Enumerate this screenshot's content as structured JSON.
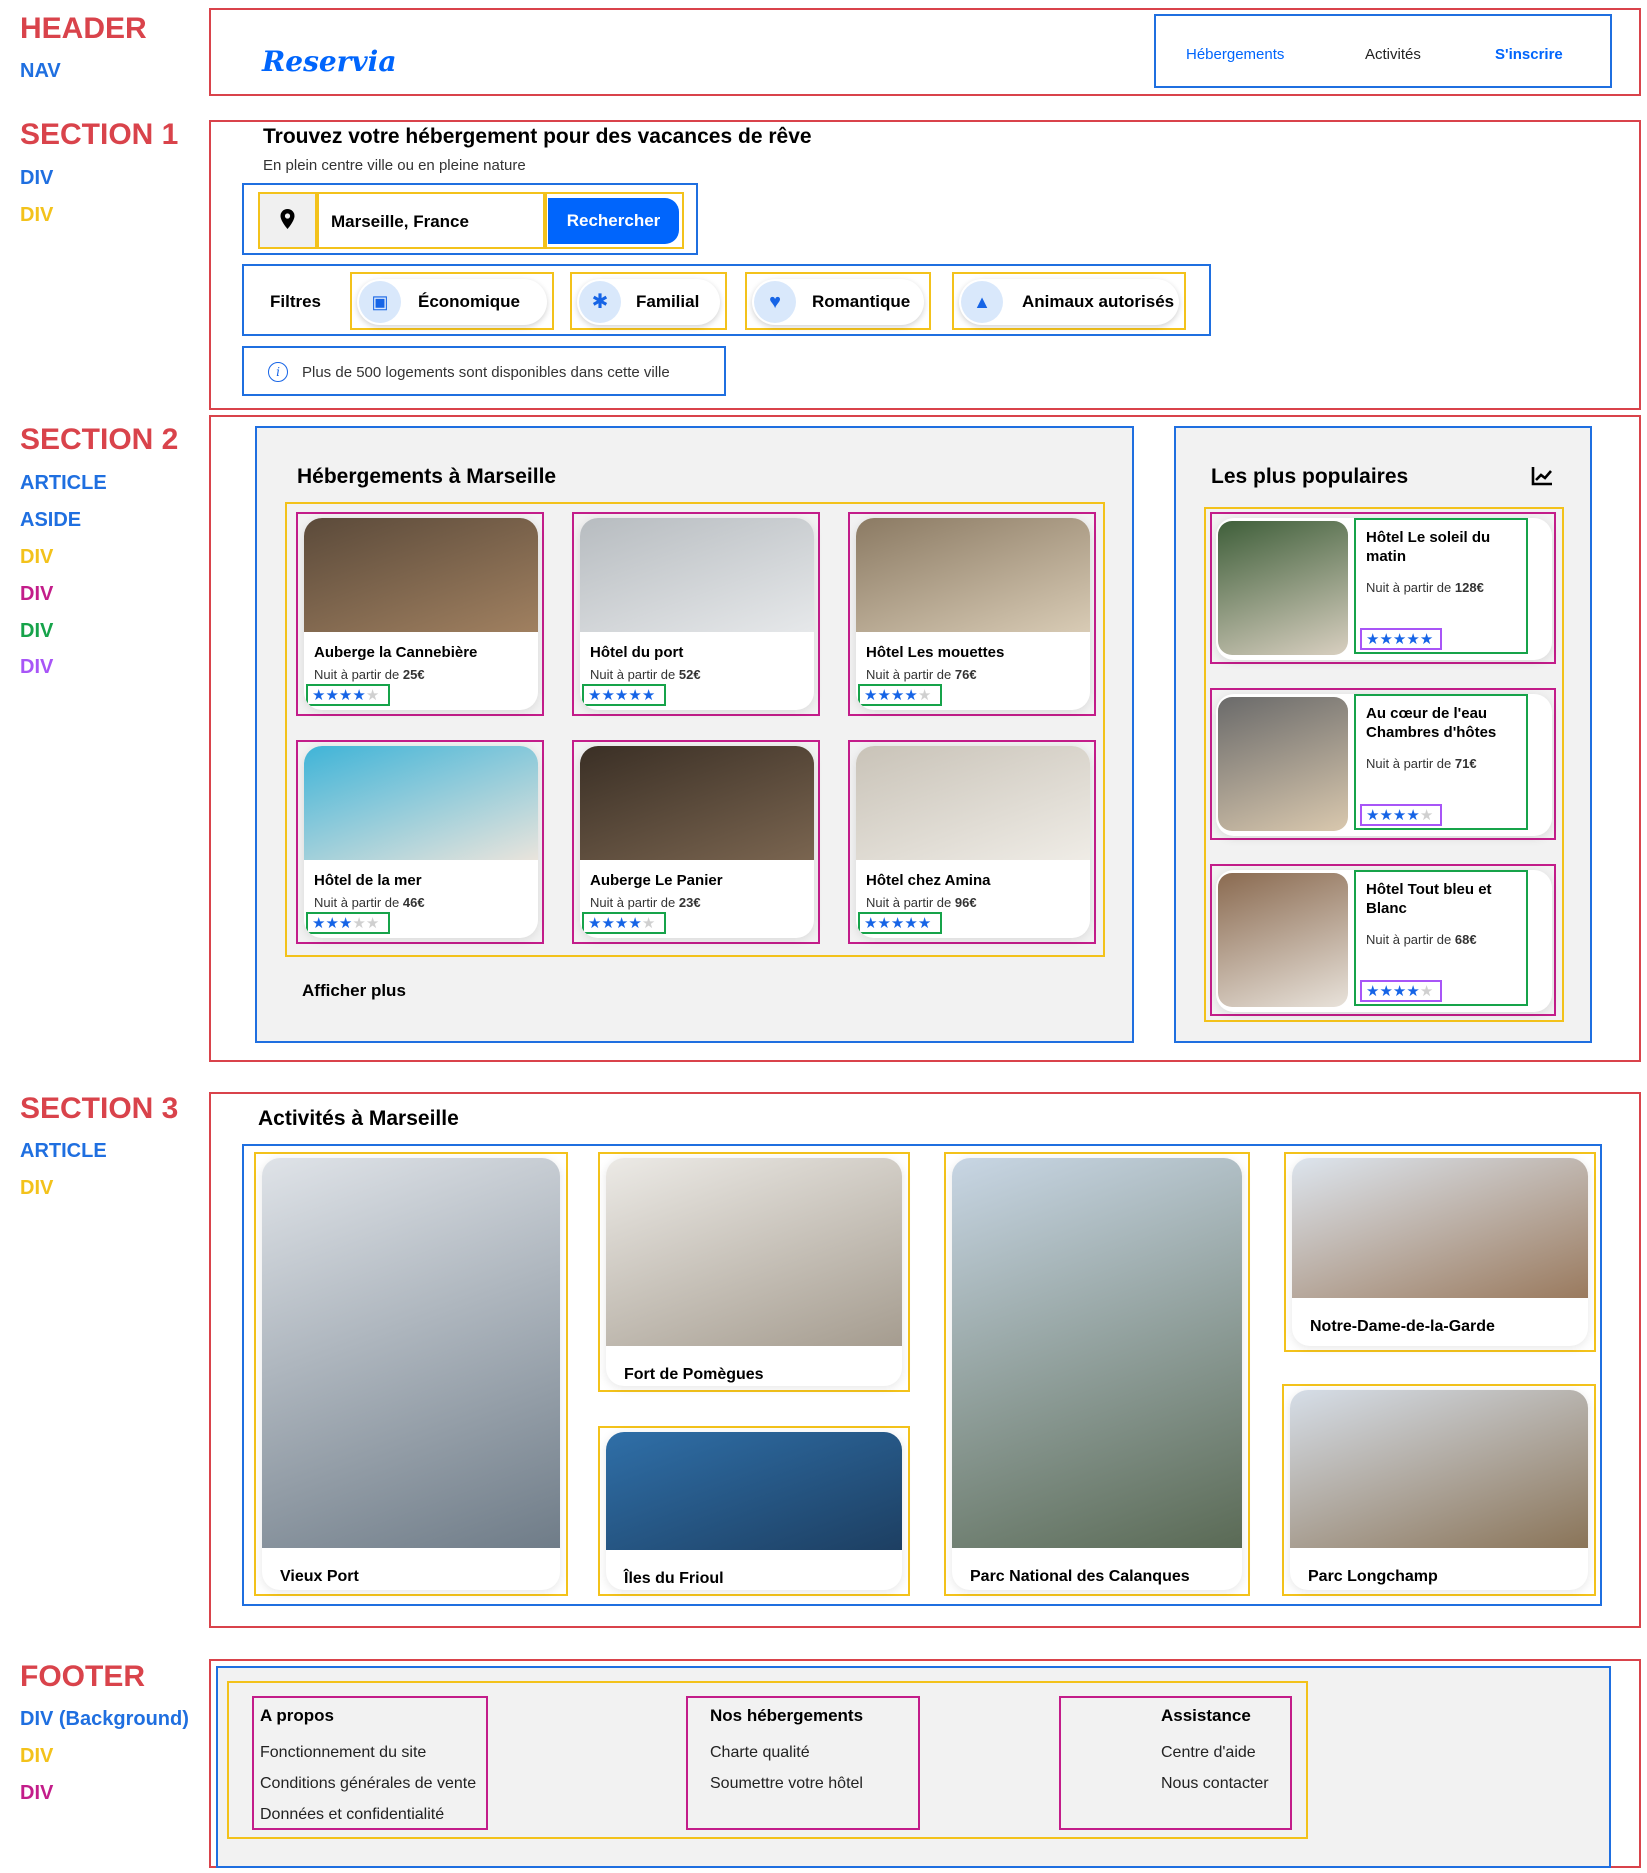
{
  "labels": {
    "header": "HEADER",
    "nav": "NAV",
    "section1": "SECTION 1",
    "div": "DIV",
    "section2": "SECTION 2",
    "article": "ARTICLE",
    "aside": "ASIDE",
    "section3": "SECTION 3",
    "footer": "FOOTER",
    "div_background": "DIV (Background)"
  },
  "brand": {
    "logo": "Reservia"
  },
  "nav": {
    "items": [
      "Hébergements",
      "Activités",
      "S'inscrire"
    ]
  },
  "hero": {
    "title": "Trouvez votre hébergement pour des vacances de rêve",
    "subtitle": "En plein centre ville ou en pleine nature",
    "search_value": "Marseille, France",
    "search_button": "Rechercher",
    "location_icon": "map-pin-icon",
    "filters_label": "Filtres",
    "filters": [
      {
        "label": "Économique",
        "icon": "money-icon"
      },
      {
        "label": "Familial",
        "icon": "person-icon"
      },
      {
        "label": "Romantique",
        "icon": "heart-icon"
      },
      {
        "label": "Animaux autorisés",
        "icon": "dog-icon"
      }
    ],
    "info_icon": "info-icon",
    "info_text": "Plus de 500 logements sont disponibles dans cette ville"
  },
  "lodging": {
    "title": "Hébergements à Marseille",
    "price_prefix": "Nuit à partir de ",
    "hotels": [
      {
        "name": "Auberge la Cannebière",
        "price": "25€",
        "stars": 4,
        "colors": [
          "#5b4a3a",
          "#a08060"
        ]
      },
      {
        "name": "Hôtel du port",
        "price": "52€",
        "stars": 5,
        "colors": [
          "#b7bcc0",
          "#e6e8ea"
        ]
      },
      {
        "name": "Hôtel Les mouettes",
        "price": "76€",
        "stars": 4,
        "colors": [
          "#8b7a63",
          "#d8cbb5"
        ]
      },
      {
        "name": "Hôtel de la mer",
        "price": "46€",
        "stars": 3,
        "colors": [
          "#3fb4d8",
          "#e9e4dc"
        ]
      },
      {
        "name": "Auberge Le Panier",
        "price": "23€",
        "stars": 4,
        "colors": [
          "#3a2f25",
          "#7a6550"
        ]
      },
      {
        "name": "Hôtel chez Amina",
        "price": "96€",
        "stars": 5,
        "colors": [
          "#c9c3b8",
          "#efece6"
        ]
      }
    ],
    "more": "Afficher plus"
  },
  "popular": {
    "title": "Les plus populaires",
    "icon": "chart-trend-icon",
    "items": [
      {
        "name": "Hôtel Le soleil du matin",
        "price": "128€",
        "stars": 5,
        "colors": [
          "#3f5f3a",
          "#d8cfc0"
        ]
      },
      {
        "name": "Au cœur de l'eau Chambres d'hôtes",
        "price": "71€",
        "stars": 4,
        "colors": [
          "#6a6a6a",
          "#d9c8ae"
        ]
      },
      {
        "name": "Hôtel Tout bleu et Blanc",
        "price": "68€",
        "stars": 4,
        "colors": [
          "#8a6a50",
          "#e8e2da"
        ]
      }
    ]
  },
  "activities": {
    "title": "Activités à Marseille",
    "items": [
      {
        "name": "Vieux Port",
        "colors": [
          "#dfe3e8",
          "#6f7c88"
        ]
      },
      {
        "name": "Fort de Pomègues",
        "colors": [
          "#eceae6",
          "#a59c8f"
        ]
      },
      {
        "name": "Îles du Frioul",
        "colors": [
          "#2f6fa8",
          "#1d3f62"
        ]
      },
      {
        "name": "Parc National des Calanques",
        "colors": [
          "#c8d6e4",
          "#5a6a55"
        ]
      },
      {
        "name": "Notre-Dame-de-la-Garde",
        "colors": [
          "#dde5ee",
          "#9a7a5e"
        ]
      },
      {
        "name": "Parc Longchamp",
        "colors": [
          "#d6dee8",
          "#8a7458"
        ]
      }
    ]
  },
  "footer": {
    "columns": [
      {
        "title": "A propos",
        "links": [
          "Fonctionnement du site",
          "Conditions générales de vente",
          "Données et confidentialité"
        ]
      },
      {
        "title": "Nos hébergements",
        "links": [
          "Charte qualité",
          "Soumettre votre hôtel"
        ]
      },
      {
        "title": "Assistance",
        "links": [
          "Centre d'aide",
          "Nous contacter"
        ]
      }
    ]
  },
  "colors": {
    "accent": "#0065fc",
    "star": "#1664e6",
    "outline_red": "#d9434b",
    "outline_blue": "#1f6fe0",
    "outline_yellow": "#f3c21b",
    "outline_magenta": "#c31d8a",
    "outline_green": "#16a34a",
    "outline_purple": "#a855f7"
  }
}
